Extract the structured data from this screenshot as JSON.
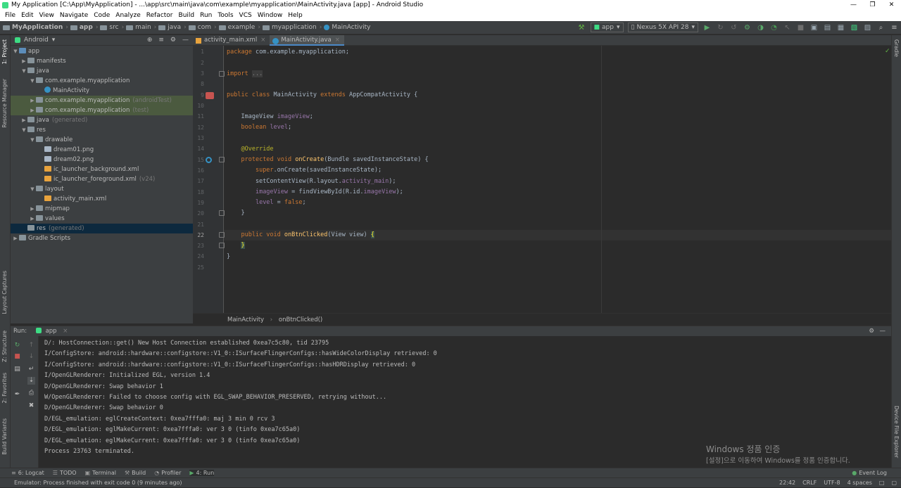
{
  "window": {
    "title": "My Application [C:\\App\\MyApplication] - ...\\app\\src\\main\\java\\com\\example\\myapplication\\MainActivity.java [app] - Android Studio"
  },
  "menu": [
    "File",
    "Edit",
    "View",
    "Navigate",
    "Code",
    "Analyze",
    "Refactor",
    "Build",
    "Run",
    "Tools",
    "VCS",
    "Window",
    "Help"
  ],
  "breadcrumbs": [
    "MyApplication",
    "app",
    "src",
    "main",
    "java",
    "com",
    "example",
    "myapplication",
    "MainActivity"
  ],
  "toolbar": {
    "run_config": "app",
    "device": "Nexus 5X API 28"
  },
  "left_tabs": [
    "1: Project",
    "Resource Manager",
    "Layout Captures",
    "Z: Structure",
    "2: Favorites",
    "Build Variants"
  ],
  "right_tabs": [
    "Gradle",
    "Device File Explorer"
  ],
  "project": {
    "view": "Android",
    "tree": [
      {
        "label": "app",
        "depth": 0,
        "arrow": "▼",
        "icon": "fold-blue"
      },
      {
        "label": "manifests",
        "depth": 1,
        "arrow": "▶",
        "icon": "fold-ico"
      },
      {
        "label": "java",
        "depth": 1,
        "arrow": "▼",
        "icon": "fold-ico"
      },
      {
        "label": "com.example.myapplication",
        "depth": 2,
        "arrow": "▼",
        "icon": "fold-ico"
      },
      {
        "label": "MainActivity",
        "depth": 3,
        "arrow": "",
        "icon": "cls-ico"
      },
      {
        "label": "com.example.myapplication",
        "suffix": "(androidTest)",
        "depth": 2,
        "arrow": "▶",
        "icon": "fold-ico",
        "hl": true
      },
      {
        "label": "com.example.myapplication",
        "suffix": "(test)",
        "depth": 2,
        "arrow": "▶",
        "icon": "fold-ico",
        "hl": true
      },
      {
        "label": "java",
        "suffix": "(generated)",
        "depth": 1,
        "arrow": "▶",
        "icon": "fold-ico"
      },
      {
        "label": "res",
        "depth": 1,
        "arrow": "▼",
        "icon": "fold-ico"
      },
      {
        "label": "drawable",
        "depth": 2,
        "arrow": "▼",
        "icon": "fold-ico"
      },
      {
        "label": "dream01.png",
        "depth": 3,
        "arrow": "",
        "icon": "file-ico"
      },
      {
        "label": "dream02.png",
        "depth": 3,
        "arrow": "",
        "icon": "file-ico"
      },
      {
        "label": "ic_launcher_background.xml",
        "depth": 3,
        "arrow": "",
        "icon": "xml-ico"
      },
      {
        "label": "ic_launcher_foreground.xml",
        "suffix": "(v24)",
        "depth": 3,
        "arrow": "",
        "icon": "xml-ico"
      },
      {
        "label": "layout",
        "depth": 2,
        "arrow": "▼",
        "icon": "fold-ico"
      },
      {
        "label": "activity_main.xml",
        "depth": 3,
        "arrow": "",
        "icon": "xml-ico"
      },
      {
        "label": "mipmap",
        "depth": 2,
        "arrow": "▶",
        "icon": "fold-ico"
      },
      {
        "label": "values",
        "depth": 2,
        "arrow": "▶",
        "icon": "fold-ico"
      },
      {
        "label": "res",
        "suffix": "(generated)",
        "depth": 1,
        "arrow": "",
        "icon": "fold-ico",
        "sel": true
      },
      {
        "label": "Gradle Scripts",
        "depth": 0,
        "arrow": "▶",
        "icon": "fold-ico"
      }
    ]
  },
  "editor": {
    "tabs": [
      {
        "label": "activity_main.xml",
        "active": false
      },
      {
        "label": "MainActivity.java",
        "active": true
      }
    ],
    "line_numbers": [
      "1",
      "2",
      "3",
      "8",
      "9",
      "10",
      "11",
      "12",
      "13",
      "14",
      "15",
      "16",
      "17",
      "18",
      "19",
      "20",
      "21",
      "22",
      "23",
      "24",
      "25"
    ],
    "breadcrumb": [
      "MainActivity",
      "onBtnClicked()"
    ]
  },
  "run": {
    "label": "Run:",
    "config": "app",
    "log": [
      "D/: HostConnection::get() New Host Connection established 0xea7c5c80, tid 23795",
      "I/ConfigStore: android::hardware::configstore::V1_0::ISurfaceFlingerConfigs::hasWideColorDisplay retrieved: 0",
      "I/ConfigStore: android::hardware::configstore::V1_0::ISurfaceFlingerConfigs::hasHDRDisplay retrieved: 0",
      "I/OpenGLRenderer: Initialized EGL, version 1.4",
      "D/OpenGLRenderer: Swap behavior 1",
      "W/OpenGLRenderer: Failed to choose config with EGL_SWAP_BEHAVIOR_PRESERVED, retrying without...",
      "D/OpenGLRenderer: Swap behavior 0",
      "D/EGL_emulation: eglCreateContext: 0xea7fffa0: maj 3 min 0 rcv 3",
      "D/EGL_emulation: eglMakeCurrent: 0xea7fffa0: ver 3 0 (tinfo 0xea7c65a0)",
      "D/EGL_emulation: eglMakeCurrent: 0xea7fffa0: ver 3 0 (tinfo 0xea7c65a0)",
      "Process 23763 terminated."
    ]
  },
  "watermark": {
    "line1": "Windows 정품 인증",
    "line2": "[설정]으로 이동하여 Windows를 정품 인증합니다."
  },
  "bottom_tabs": [
    "6: Logcat",
    "TODO",
    "Terminal",
    "Build",
    "Profiler",
    "4: Run"
  ],
  "event_log": "Event Log",
  "status": {
    "message": "Emulator: Process finished with exit code 0 (9 minutes ago)",
    "position": "22:42",
    "line_sep": "CRLF",
    "encoding": "UTF-8",
    "indent": "4 spaces"
  }
}
